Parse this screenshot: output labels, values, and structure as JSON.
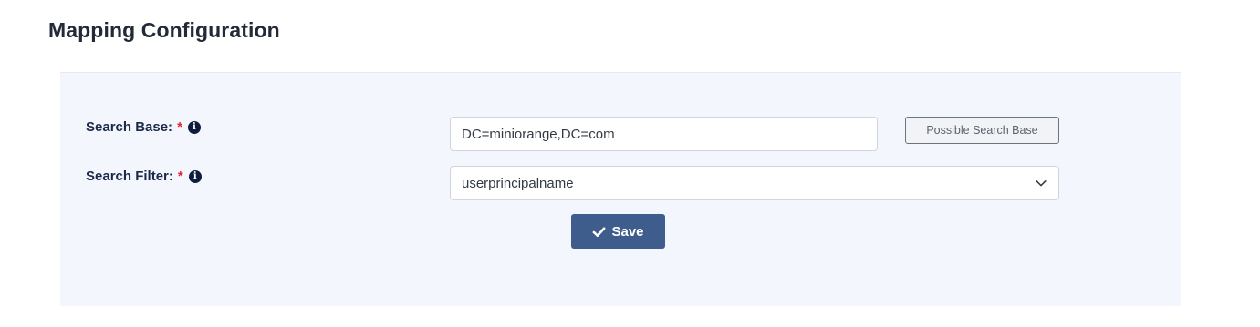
{
  "page": {
    "title": "Mapping Configuration"
  },
  "form": {
    "search_base": {
      "label": "Search Base:",
      "required_mark": "*",
      "value": "DC=miniorange,DC=com"
    },
    "search_filter": {
      "label": "Search Filter:",
      "required_mark": "*",
      "selected": "userprincipalname"
    },
    "possible_search_base_label": "Possible Search Base",
    "save_label": "Save"
  },
  "icons": {
    "info": "info-icon",
    "dropdown": "chevron-down-icon",
    "save": "check-icon"
  },
  "colors": {
    "accent": "#3e5d8c",
    "required": "#e0243a",
    "panel_bg": "#f3f7fd"
  }
}
